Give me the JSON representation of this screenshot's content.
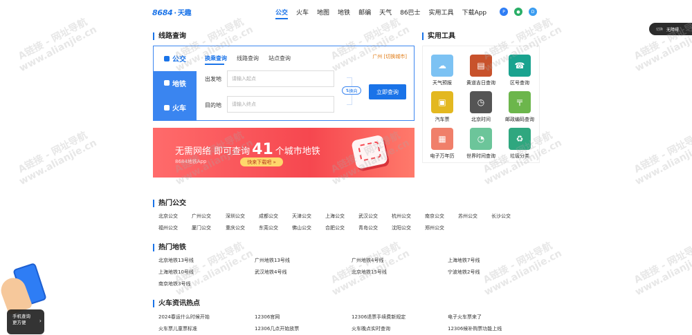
{
  "header": {
    "logo_main": "8684",
    "logo_sub": "天趣",
    "nav": [
      "公交",
      "火车",
      "地图",
      "地铁",
      "邮编",
      "天气",
      "86巴士",
      "实用工具",
      "下载App"
    ],
    "icons": [
      "p-icon",
      "wechat-icon",
      "d-icon"
    ]
  },
  "route": {
    "title": "线路查询",
    "modes": [
      "公交",
      "地铁",
      "火车"
    ],
    "subtabs": [
      "换乘查询",
      "线路查询",
      "站点查询"
    ],
    "city": "广州 [切换城市]",
    "from_label": "出发地",
    "from_placeholder": "请输入起点",
    "to_label": "目的地",
    "to_placeholder": "请输入终点",
    "swap_label": "换向",
    "query_btn": "立即查询"
  },
  "banner": {
    "text_before": "无需网络 即可查询",
    "number": "41",
    "text_after": "个城市地铁",
    "subtext": "8684地铁App",
    "button": "快来下载吧 »"
  },
  "tools": {
    "title": "实用工具",
    "items": [
      {
        "label": "天气预报",
        "icon": "weather-icon",
        "color": "#7cc2f3"
      },
      {
        "label": "黄道吉日查询",
        "icon": "almanac-icon",
        "color": "#c8522c"
      },
      {
        "label": "区号查询",
        "icon": "phone-icon",
        "color": "#1aa38f"
      },
      {
        "label": "汽车票",
        "icon": "bus-icon",
        "color": "#e3b820"
      },
      {
        "label": "北京时间",
        "icon": "clock-icon",
        "color": "#555555"
      },
      {
        "label": "邮政编码查询",
        "icon": "postal-icon",
        "color": "#6cb64c"
      },
      {
        "label": "电子万年历",
        "icon": "calendar-icon",
        "color": "#f07f6a"
      },
      {
        "label": "世界时间查询",
        "icon": "world-clock-icon",
        "color": "#6cc59a"
      },
      {
        "label": "垃圾分类",
        "icon": "trash-icon",
        "color": "#2fa77f"
      }
    ]
  },
  "hot_bus": {
    "title": "热门公交",
    "row1": [
      "北京公交",
      "广州公交",
      "深圳公交",
      "成都公交",
      "天津公交",
      "上海公交",
      "武汉公交",
      "杭州公交",
      "南京公交",
      "苏州公交",
      "长沙公交"
    ],
    "row2": [
      "福州公交",
      "厦门公交",
      "重庆公交",
      "东莞公交",
      "佛山公交",
      "合肥公交",
      "青岛公交",
      "沈阳公交",
      "郑州公交"
    ]
  },
  "hot_metro": {
    "title": "热门地铁",
    "items": [
      "北京地铁13号线",
      "广州地铁13号线",
      "广州地铁4号线",
      "上海地铁7号线",
      "上海地铁10号线",
      "武汉地铁4号线",
      "北京地铁15号线",
      "宁波地铁2号线",
      "南京地铁3号线"
    ]
  },
  "train_news": {
    "title": "火车资讯热点",
    "items": [
      "2024春运什么时候开始",
      "12306官网",
      "12306退票手续费新规定",
      "电子火车票来了",
      "火车票儿童票标准",
      "12306几点开始放票",
      "火车晚点实时查询",
      "12306候补购票功能上线"
    ]
  },
  "watermark": {
    "line1": "A链接 - 网址导航",
    "line2": "www.alianjie.cn"
  },
  "side_tab": {
    "small": "切换",
    "label": "无障碍"
  },
  "float": {
    "line1": "手机查询",
    "line2": "更方便",
    "arrow": "›"
  }
}
